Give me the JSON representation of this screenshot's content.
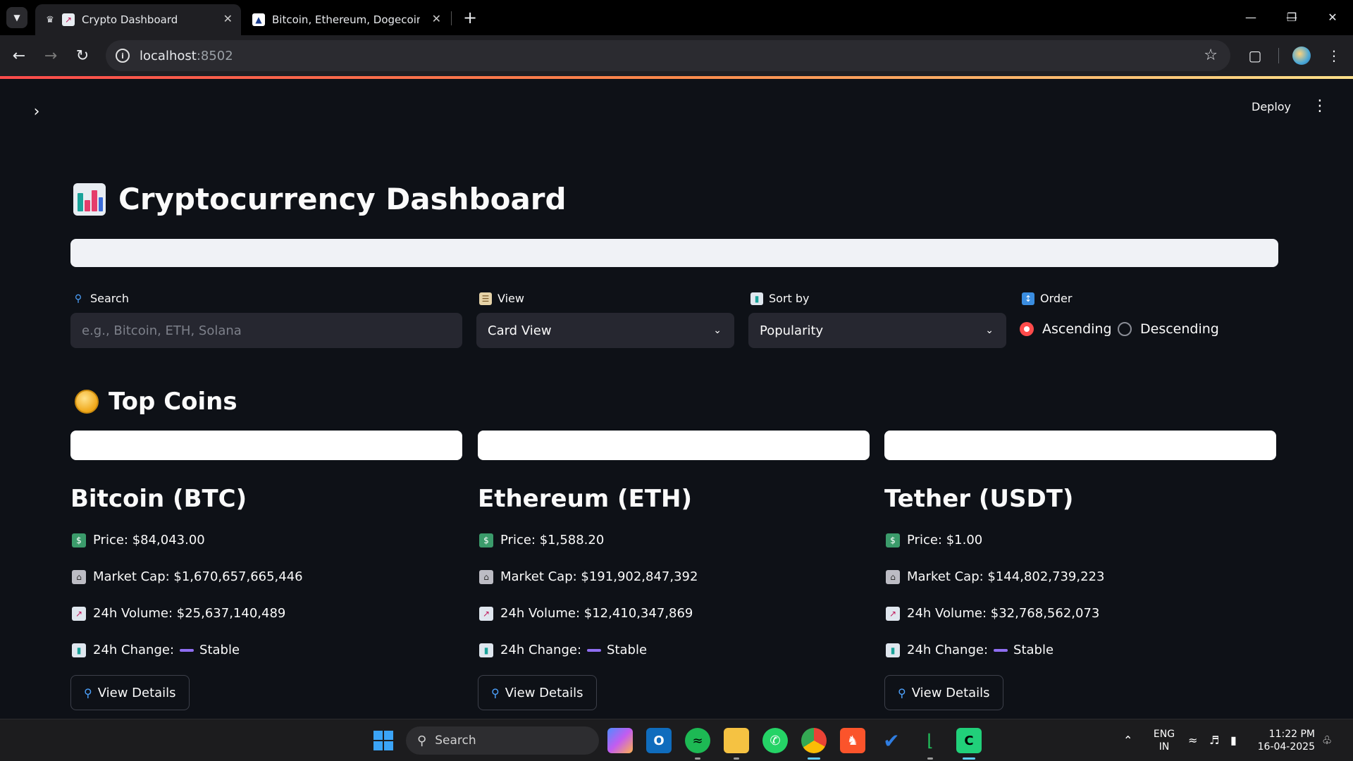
{
  "browser": {
    "tabs": [
      {
        "title": "Crypto Dashboard",
        "active": true
      },
      {
        "title": "Bitcoin, Ethereum, Dogecoin M",
        "active": false
      }
    ],
    "url_host": "localhost",
    "url_port": ":8502"
  },
  "app": {
    "deploy_label": "Deploy",
    "title": "Cryptocurrency Dashboard",
    "controls": {
      "search": {
        "label": "Search",
        "placeholder": "e.g., Bitcoin, ETH, Solana",
        "value": ""
      },
      "view": {
        "label": "View",
        "selected": "Card View"
      },
      "sort": {
        "label": "Sort by",
        "selected": "Popularity"
      },
      "order": {
        "label": "Order",
        "options": [
          "Ascending",
          "Descending"
        ],
        "selected": "Ascending"
      }
    },
    "section_title": "Top Coins",
    "coins": [
      {
        "name": "Bitcoin (BTC)",
        "price": "Price: $84,043.00",
        "market_cap": "Market Cap: $1,670,657,665,446",
        "volume": "24h Volume: $25,637,140,489",
        "change_label": "24h Change:",
        "change_value": "Stable",
        "button": "View Details"
      },
      {
        "name": "Ethereum (ETH)",
        "price": "Price: $1,588.20",
        "market_cap": "Market Cap: $191,902,847,392",
        "volume": "24h Volume: $12,410,347,869",
        "change_label": "24h Change:",
        "change_value": "Stable",
        "button": "View Details"
      },
      {
        "name": "Tether (USDT)",
        "price": "Price: $1.00",
        "market_cap": "Market Cap: $144,802,739,223",
        "volume": "24h Volume: $32,768,562,073",
        "change_label": "24h Change:",
        "change_value": "Stable",
        "button": "View Details"
      }
    ],
    "colors": {
      "accent": "#ff4b4b",
      "background": "#0e1117",
      "input_bg": "#262730",
      "stable": "#8f6ef2"
    }
  },
  "taskbar": {
    "search_label": "Search",
    "language": "ENG",
    "region": "IN",
    "time": "11:22 PM",
    "date": "16-04-2025"
  }
}
